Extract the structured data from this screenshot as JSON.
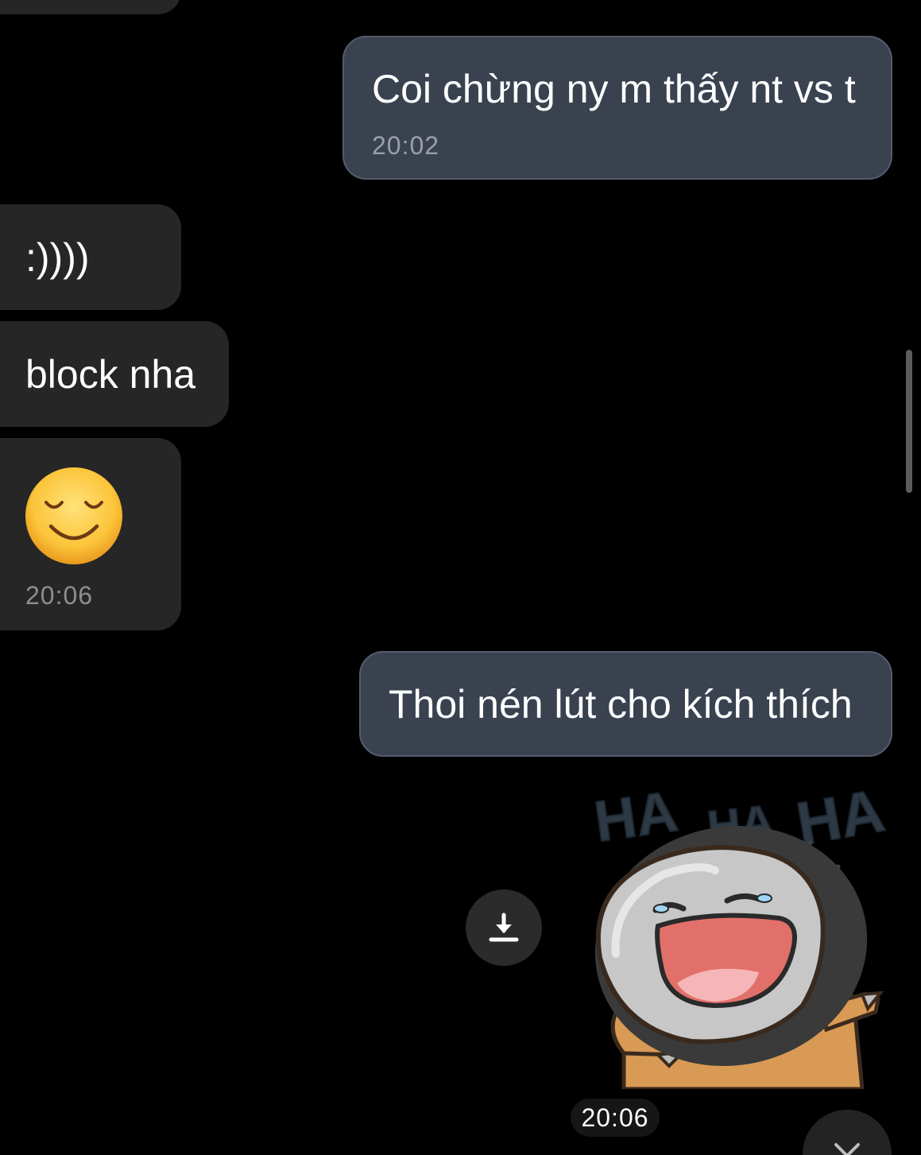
{
  "messages": [
    {
      "text": "Coi chừng ny m thấy nt vs t",
      "time": "20:02"
    },
    {
      "text": ":))))"
    },
    {
      "text": "block nha"
    },
    {
      "emoji": "relieved-face-icon",
      "time": "20:06"
    },
    {
      "text": "Thoi nén lút cho kích thích"
    }
  ],
  "sticker": {
    "icon": "laughing-character-sticker-icon",
    "text": [
      "HA",
      "HA",
      "HA"
    ],
    "time": "20:06"
  },
  "colors": {
    "background": "#000000",
    "incoming_bubble": "#262626",
    "outgoing_bubble": "#3a4250",
    "outgoing_border": "#535c6c"
  }
}
